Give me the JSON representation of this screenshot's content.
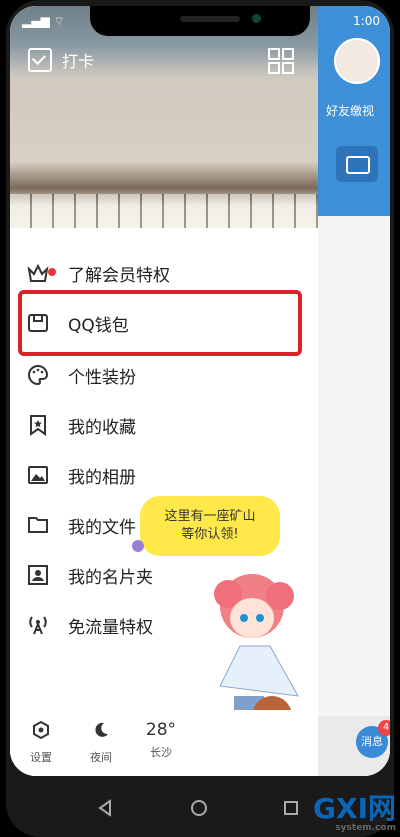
{
  "status": {
    "left": "▂▄▆ ⌔",
    "time": "1:00"
  },
  "header": {
    "checkin_label": "打卡"
  },
  "right_panel": {
    "friend_label": "好友缴视",
    "msg_badge": "4",
    "msg_label": "消息"
  },
  "menu": {
    "items": [
      {
        "label": "了解会员特权",
        "icon": "crown-icon"
      },
      {
        "label": "QQ钱包",
        "icon": "wallet-icon"
      },
      {
        "label": "个性装扮",
        "icon": "palette-icon"
      },
      {
        "label": "我的收藏",
        "icon": "bookmark-star-icon"
      },
      {
        "label": "我的相册",
        "icon": "photo-icon"
      },
      {
        "label": "我的文件",
        "icon": "folder-icon"
      },
      {
        "label": "我的名片夹",
        "icon": "contact-card-icon"
      },
      {
        "label": "免流量特权",
        "icon": "antenna-icon"
      }
    ]
  },
  "bubble": {
    "line1": "这里有一座矿山",
    "line2": "等你认领!"
  },
  "bottom": {
    "settings": "设置",
    "night": "夜间",
    "temp": "28°",
    "city": "长沙"
  },
  "watermark": {
    "brand": "GXI网",
    "domain": "system.com"
  }
}
